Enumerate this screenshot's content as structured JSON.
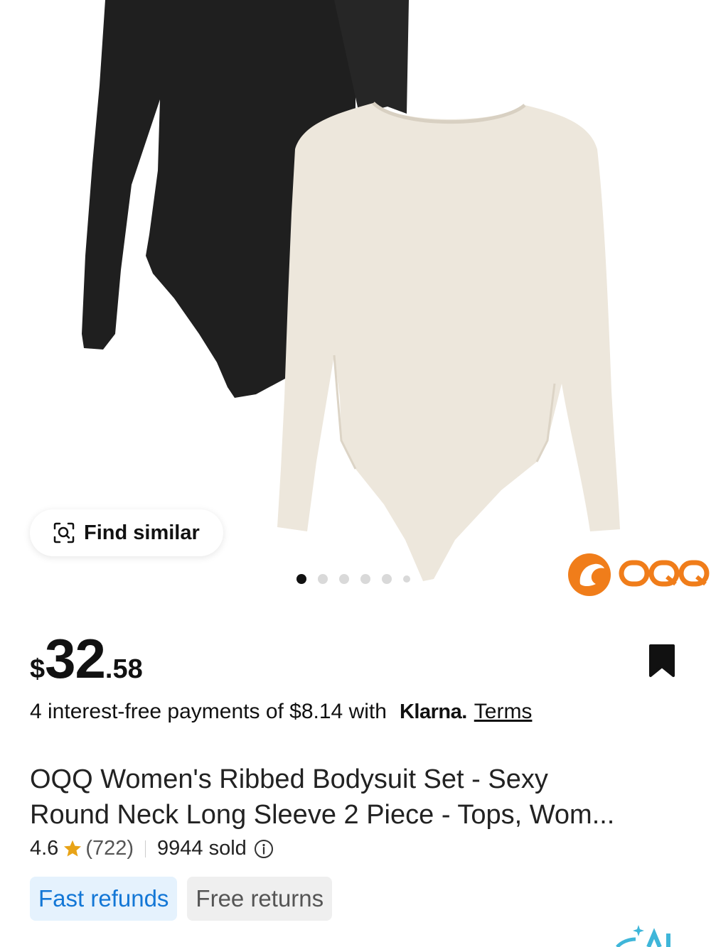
{
  "find_similar": {
    "label": "Find similar",
    "icon": "search-image-icon"
  },
  "carousel": {
    "total_dots": 6,
    "active_index": 0
  },
  "brand_logo": {
    "text": "OQQ",
    "color": "#f07d1a"
  },
  "price": {
    "currency": "$",
    "integer": "32",
    "decimal": ".58"
  },
  "installments": {
    "text": "4 interest-free payments of $8.14 with",
    "provider": "Klarna.",
    "terms_label": "Terms"
  },
  "product": {
    "title_line1": "OQQ Women's Ribbed Bodysuit Set - Sexy",
    "title_line2": "Round Neck Long Sleeve 2 Piece - Tops, Wom..."
  },
  "rating": {
    "score": "4.6",
    "count": "(722)",
    "sold": "9944 sold",
    "star_color": "#e8a317"
  },
  "tags": [
    {
      "label": "Fast refunds"
    },
    {
      "label": "Free returns"
    }
  ],
  "colors": {
    "accent_blue": "#1377d6",
    "tag_blue_bg": "#e5f2fd"
  }
}
